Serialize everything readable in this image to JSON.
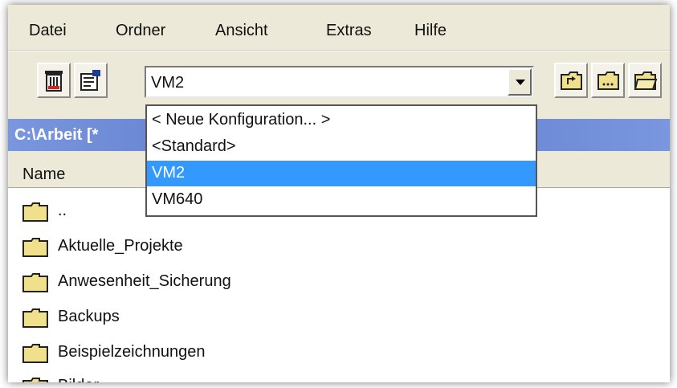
{
  "menu": [
    "Datei",
    "Ordner",
    "Ansicht",
    "Extras",
    "Hilfe"
  ],
  "toolbar": {
    "config_combo": {
      "selected": "VM2"
    }
  },
  "dropdown": {
    "options": [
      "< Neue Konfiguration... >",
      "<Standard>",
      "VM2",
      "VM640"
    ],
    "selected_index": 2
  },
  "path_bar": {
    "text": "C:\\Arbeit [*"
  },
  "file_list": {
    "column_name": "Name",
    "items": [
      "..",
      "Aktuelle_Projekte",
      "Anwesenheit_Sicherung",
      "Backups",
      "Beispielzeichnungen",
      "Bilder"
    ]
  },
  "colors": {
    "selection": "#3399ff",
    "path_bar": "#5b79c9",
    "folder": "#f0e08c"
  }
}
